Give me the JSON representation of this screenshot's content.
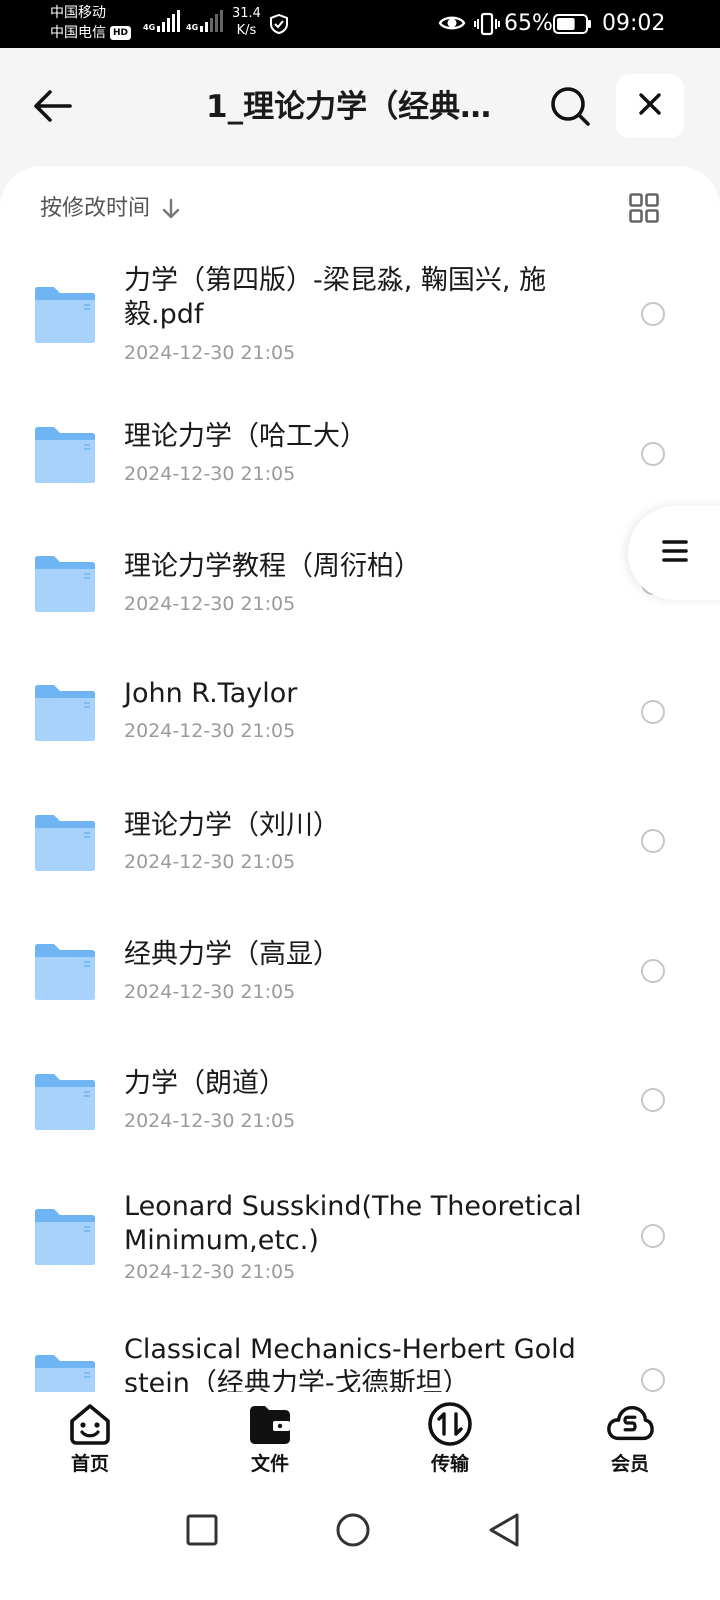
{
  "status_bar": {
    "carrier_1": "中国移动",
    "carrier_2": "中国电信",
    "hd_badge": "HD",
    "sim1_tag": "4G",
    "sim2_tag": "4G",
    "net_speed_value": "31.4",
    "net_speed_unit": "K/s",
    "battery_percent": "65%",
    "battery_level": 0.65,
    "time": "09:02",
    "icons": [
      "signal-icon",
      "shield-icon",
      "eye-icon",
      "vibrate-icon",
      "battery-icon"
    ]
  },
  "header": {
    "title": "1_理论力学（经典…",
    "back_icon": "arrow-left-icon",
    "search_icon": "search-icon",
    "close_icon": "close-icon"
  },
  "toolbar": {
    "sort_label": "按修改时间",
    "sort_icon": "arrow-down-icon",
    "view_icon": "grid-view-icon"
  },
  "side_button": {
    "icon": "menu-icon"
  },
  "files": [
    {
      "name": "力学（第四版）-梁昆淼, 鞠国兴, 施\n毅.pdf",
      "date": "2024-12-30 21:05",
      "icon": "folder-icon"
    },
    {
      "name": "理论力学（哈工大）",
      "date": "2024-12-30 21:05",
      "icon": "folder-icon"
    },
    {
      "name": "理论力学教程（周衍柏）",
      "date": "2024-12-30 21:05",
      "icon": "folder-icon"
    },
    {
      "name": "John R.Taylor",
      "date": "2024-12-30 21:05",
      "icon": "folder-icon"
    },
    {
      "name": "理论力学（刘川）",
      "date": "2024-12-30 21:05",
      "icon": "folder-icon"
    },
    {
      "name": "经典力学（高显）",
      "date": "2024-12-30 21:05",
      "icon": "folder-icon"
    },
    {
      "name": "力学（朗道）",
      "date": "2024-12-30 21:05",
      "icon": "folder-icon"
    },
    {
      "name": "Leonard Susskind(The Theoretical\n Minimum,etc.)",
      "date": "2024-12-30 21:05",
      "icon": "folder-icon"
    },
    {
      "name": "Classical Mechanics-Herbert Gold\nstein（经典力学-戈德斯坦）",
      "date": "",
      "icon": "folder-icon"
    }
  ],
  "bottom_nav": [
    {
      "label": "首页",
      "icon": "home-smile-icon"
    },
    {
      "label": "文件",
      "icon": "folder-wallet-icon"
    },
    {
      "label": "传输",
      "icon": "transfer-icon"
    },
    {
      "label": "会员",
      "icon": "cloud-s-icon"
    }
  ],
  "system_nav": [
    "recents-square-icon",
    "home-circle-icon",
    "back-triangle-icon"
  ],
  "colors": {
    "folder": "#6fb4f3",
    "folder_light": "#a6d2fb",
    "text_primary": "#1a1a1a",
    "text_secondary": "#9a9a9a",
    "status_bar_bg": "#000000",
    "header_bg": "#f5f5f5",
    "panel_bg": "#ffffff"
  }
}
